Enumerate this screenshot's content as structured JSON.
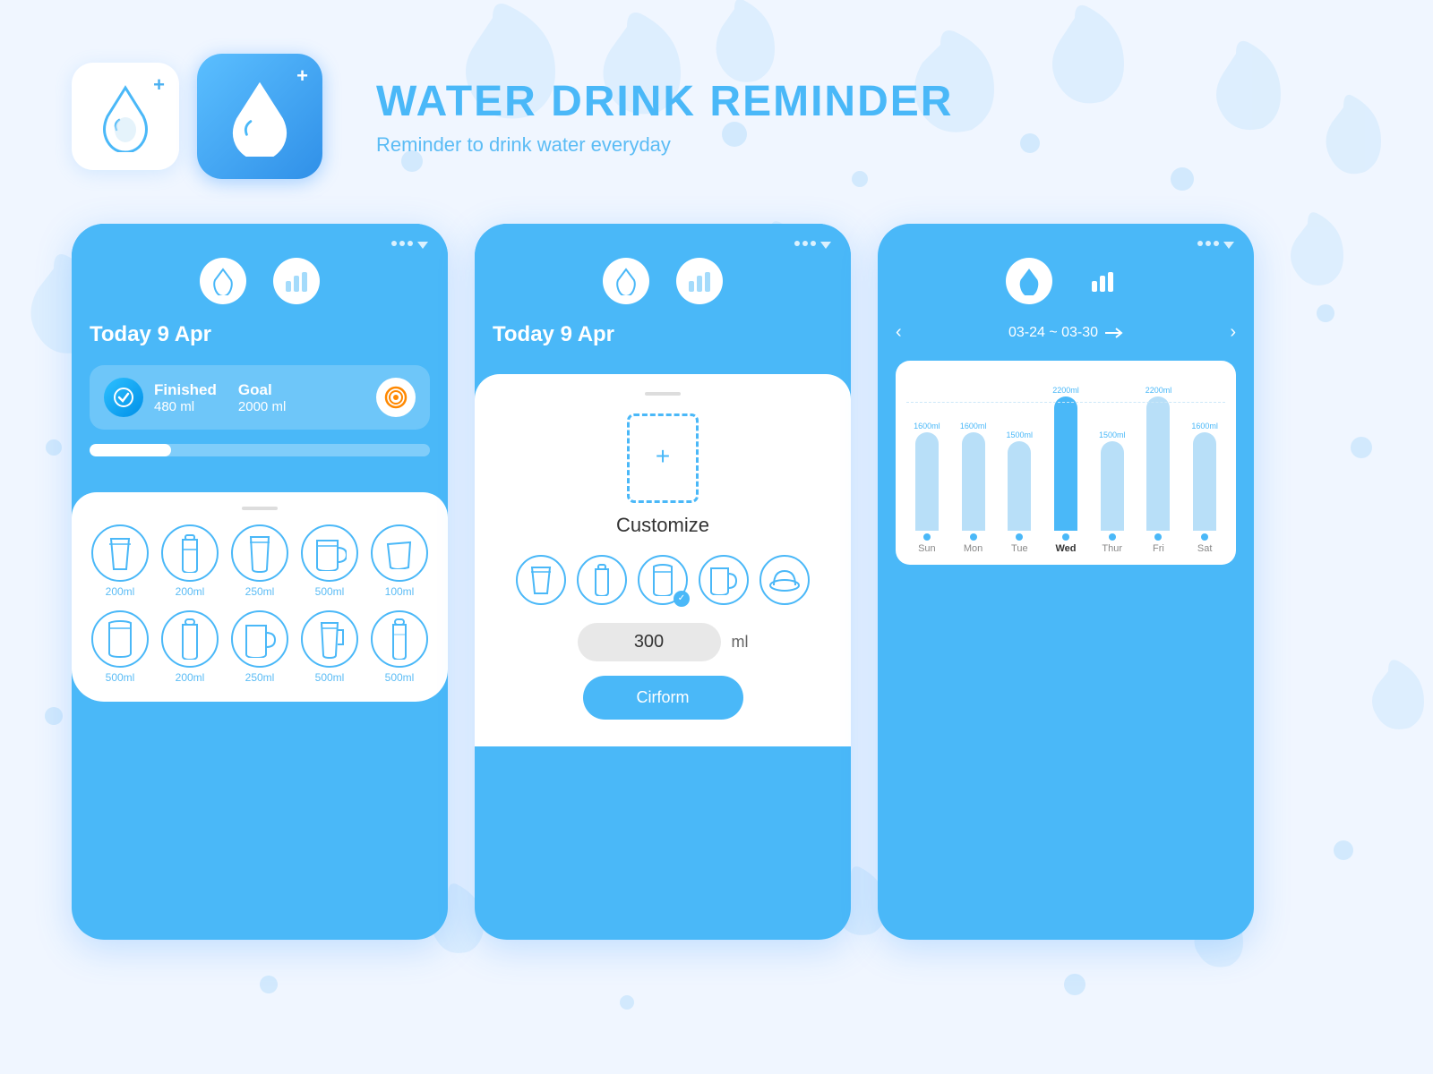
{
  "header": {
    "title": "WATER DRINK REMINDER",
    "subtitle": "Reminder to drink water everyday"
  },
  "phone1": {
    "date": "Today  9 Apr",
    "finished_label": "Finished",
    "finished_value": "480 ml",
    "goal_label": "Goal",
    "goal_value": "2000 ml",
    "progress_percent": 24,
    "drinks_row1": [
      {
        "label": "200ml"
      },
      {
        "label": "200ml"
      },
      {
        "label": "250ml"
      },
      {
        "label": "500ml"
      },
      {
        "label": "100ml"
      }
    ],
    "drinks_row2": [
      {
        "label": "500ml"
      },
      {
        "label": "200ml"
      },
      {
        "label": "250ml"
      },
      {
        "label": "500ml"
      },
      {
        "label": "500ml"
      }
    ]
  },
  "phone2": {
    "date": "Today  9 Apr",
    "customize_label": "Customize",
    "amount_value": "300",
    "amount_unit": "ml",
    "confirm_label": "Cirform"
  },
  "phone3": {
    "week_range": "03-24 ~ 03-30",
    "days": [
      "Sun",
      "Mon",
      "Tue",
      "Wed",
      "Thur",
      "Fri",
      "Sat"
    ],
    "bars": [
      {
        "value": 1600,
        "label": "1600ml",
        "type": "light"
      },
      {
        "value": 1600,
        "label": "1600ml",
        "type": "light"
      },
      {
        "value": 1500,
        "label": "1500ml",
        "type": "light"
      },
      {
        "value": 2200,
        "label": "2200ml",
        "type": "dark"
      },
      {
        "value": 1500,
        "label": "1500ml",
        "type": "light"
      },
      {
        "value": 2200,
        "label": "2200ml",
        "type": "light"
      },
      {
        "value": 1600,
        "label": "1600ml",
        "type": "light"
      }
    ],
    "max_value": 2200
  }
}
